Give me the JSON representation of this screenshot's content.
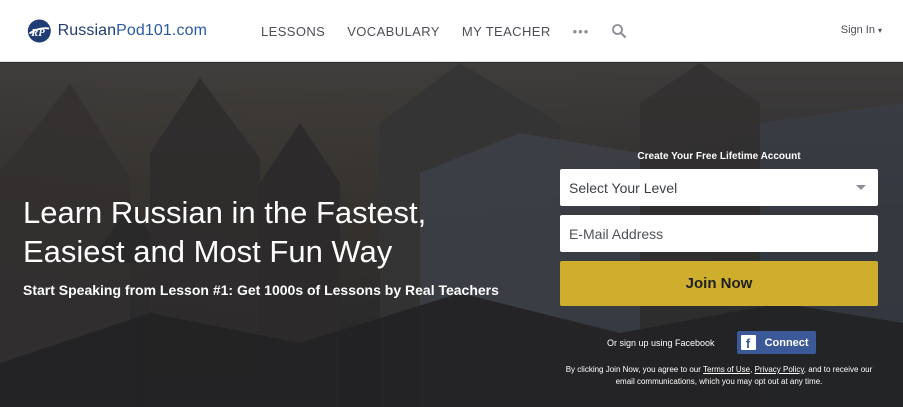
{
  "header": {
    "logo_text_russian": "Russian",
    "logo_text_pod": "Pod101.com",
    "logo_mark": "RP",
    "nav": {
      "lessons": "LESSONS",
      "vocabulary": "VOCABULARY",
      "my_teacher": "MY TEACHER",
      "more": "•••"
    },
    "search_icon": "search-icon",
    "sign_in": "Sign In",
    "sign_in_caret": "▾"
  },
  "hero": {
    "headline_line1": "Learn Russian in the Fastest,",
    "headline_line2": "Easiest and Most Fun Way",
    "subheadline": "Start Speaking from Lesson #1: Get 1000s of Lessons by Real Teachers"
  },
  "signup": {
    "title": "Create Your Free Lifetime Account",
    "level_placeholder": "Select Your Level",
    "email_placeholder": "E-Mail Address",
    "join_label": "Join Now",
    "facebook_text": "Or sign up using Facebook",
    "facebook_icon": "f",
    "facebook_connect": "Connect",
    "legal_prefix": "By clicking Join Now, you agree to our",
    "terms": "Terms of Use",
    "privacy": "Privacy Policy",
    "legal_suffix": "and to receive our email communications, which you may opt out at any time."
  },
  "colors": {
    "brand_navy": "#1f3c74",
    "join_gold": "#cfae2d",
    "facebook_blue": "#3b5998"
  }
}
